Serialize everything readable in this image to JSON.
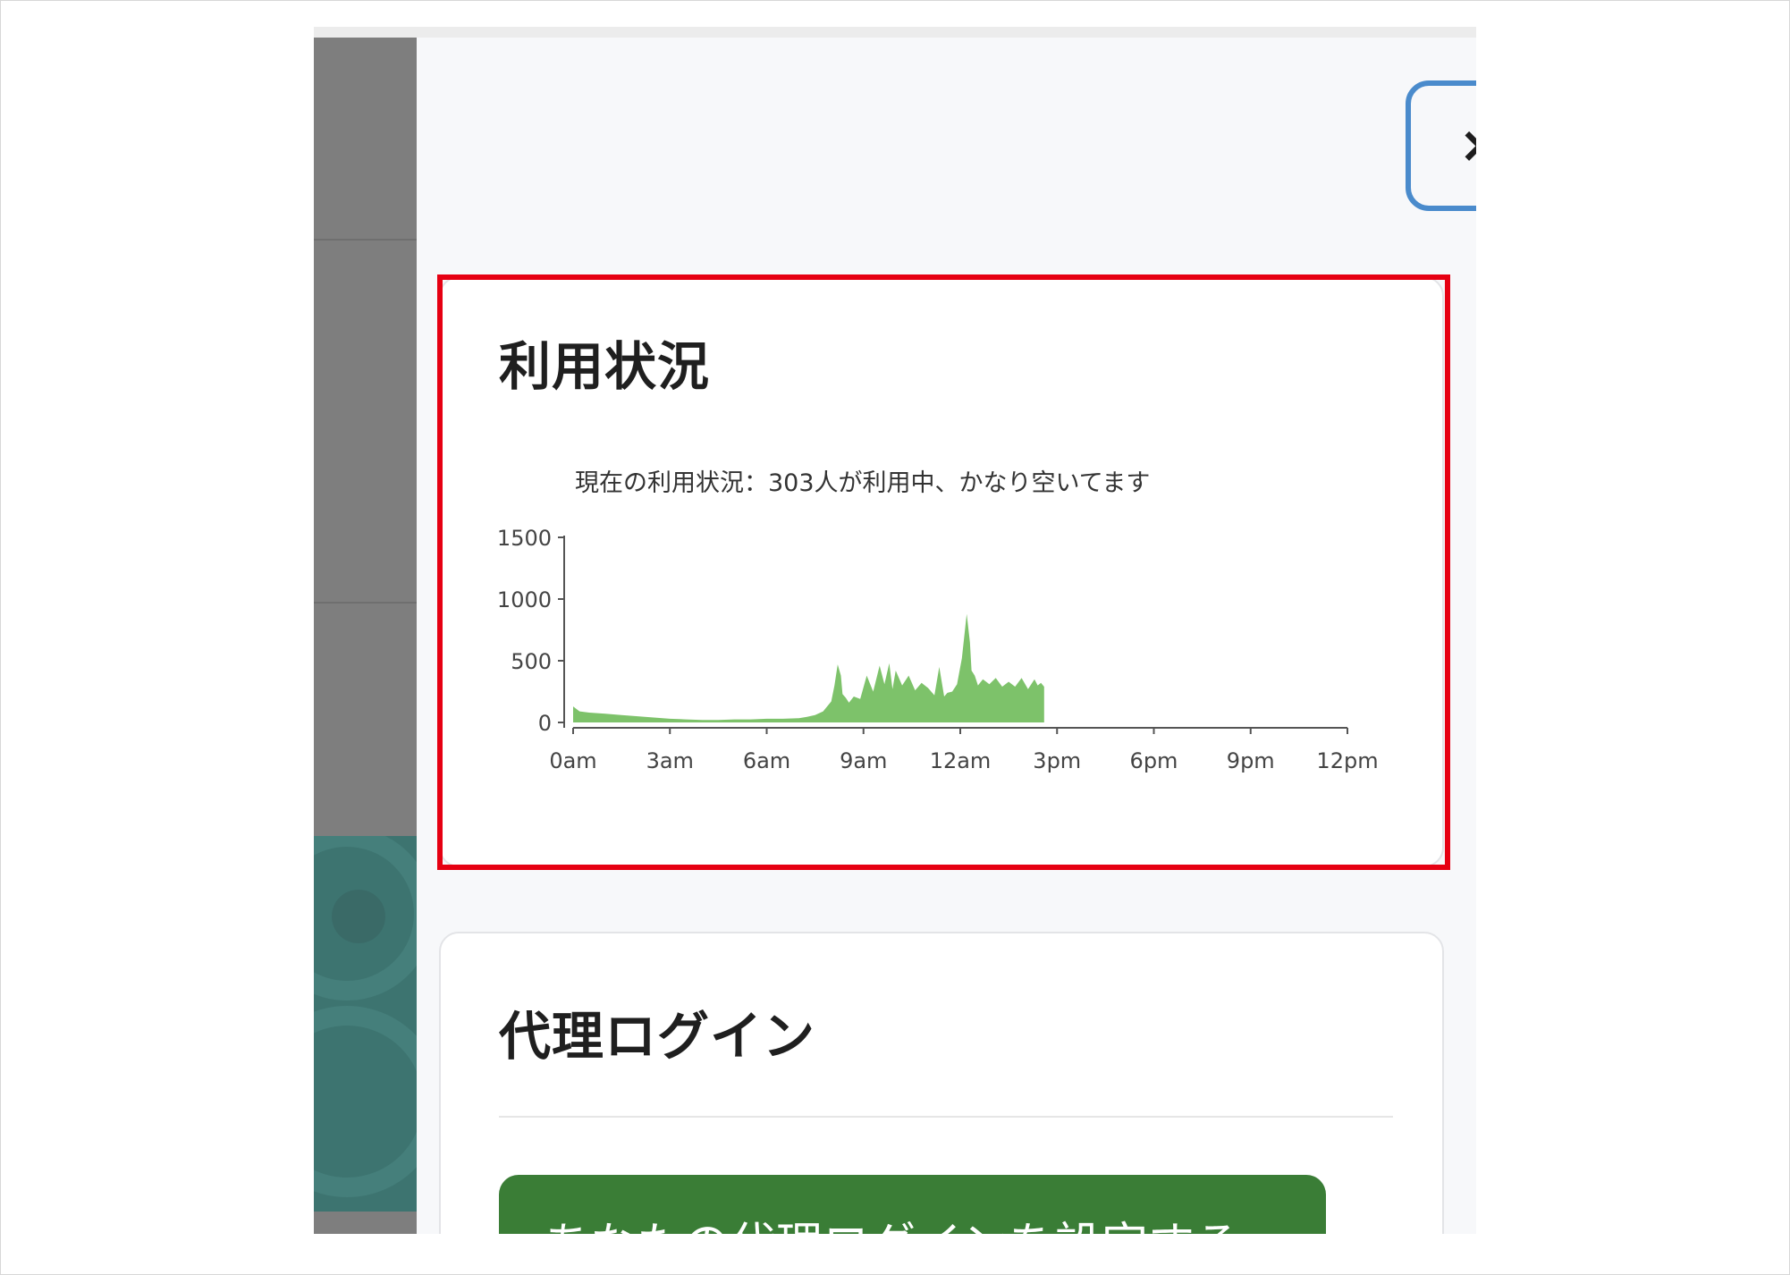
{
  "close_button": {
    "label": "×"
  },
  "usage_card": {
    "title": "利用状況"
  },
  "chart_data": {
    "type": "area",
    "title": "現在の利用状況：303人が利用中、かなり空いてます",
    "xlabel": "",
    "ylabel": "",
    "ylim": [
      0,
      1500
    ],
    "xlim": [
      0,
      24
    ],
    "y_ticks": [
      0,
      500,
      1000,
      1500
    ],
    "x_ticks": [
      {
        "x": 0,
        "label": "0am"
      },
      {
        "x": 3,
        "label": "3am"
      },
      {
        "x": 6,
        "label": "6am"
      },
      {
        "x": 9,
        "label": "9am"
      },
      {
        "x": 12,
        "label": "12am"
      },
      {
        "x": 15,
        "label": "3pm"
      },
      {
        "x": 18,
        "label": "6pm"
      },
      {
        "x": 21,
        "label": "9pm"
      },
      {
        "x": 24,
        "label": "12pm"
      }
    ],
    "fill_color": "#7dc26a",
    "series": [
      {
        "x": [
          0,
          0.2,
          0.5,
          1,
          1.5,
          2,
          2.5,
          3,
          3.5,
          4,
          4.5,
          5,
          5.5,
          6,
          6.5,
          7,
          7.25,
          7.5,
          7.75,
          8,
          8.1,
          8.2,
          8.3,
          8.35,
          8.45,
          8.55,
          8.7,
          8.9,
          9.1,
          9.3,
          9.5,
          9.65,
          9.8,
          9.9,
          10.0,
          10.2,
          10.4,
          10.6,
          10.8,
          11.0,
          11.2,
          11.35,
          11.5,
          11.6,
          11.75,
          11.9,
          12.05,
          12.2,
          12.3,
          12.35,
          12.45,
          12.55,
          12.7,
          12.9,
          13.1,
          13.3,
          13.5,
          13.7,
          13.9,
          14.1,
          14.3,
          14.4,
          14.5,
          14.6
        ],
        "y": [
          130,
          90,
          80,
          70,
          60,
          50,
          40,
          30,
          25,
          20,
          20,
          25,
          25,
          30,
          30,
          35,
          45,
          60,
          90,
          170,
          300,
          470,
          380,
          230,
          200,
          160,
          210,
          190,
          380,
          250,
          460,
          310,
          480,
          270,
          420,
          300,
          380,
          260,
          320,
          280,
          220,
          450,
          210,
          240,
          250,
          310,
          520,
          880,
          650,
          420,
          380,
          300,
          350,
          310,
          360,
          290,
          330,
          290,
          360,
          270,
          350,
          300,
          320,
          290
        ]
      }
    ]
  },
  "proxy_card": {
    "title": "代理ログイン",
    "button_label": "あなたの代理ログインを設定する"
  },
  "colors": {
    "highlight_border": "#e60012",
    "close_border": "#4a8bcc",
    "button_green": "#3a7d36",
    "chart_green": "#7dc26a"
  }
}
